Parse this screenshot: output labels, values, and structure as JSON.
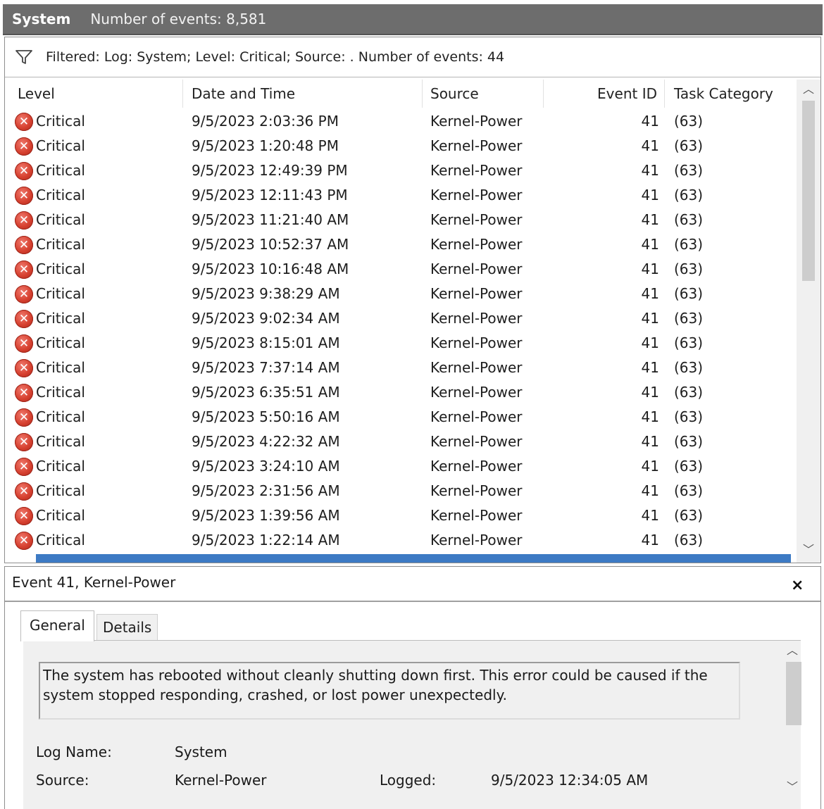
{
  "header": {
    "title": "System",
    "event_count": "Number of events: 8,581"
  },
  "filter": {
    "text": "Filtered: Log: System; Level: Critical; Source: . Number of events: 44",
    "icon": "filter-icon"
  },
  "columns": {
    "level": "Level",
    "date": "Date and Time",
    "source": "Source",
    "event_id": "Event ID",
    "task": "Task Category"
  },
  "rows": [
    {
      "level": "Critical",
      "date": "9/5/2023 2:03:36 PM",
      "source": "Kernel-Power",
      "event_id": "41",
      "task": "(63)"
    },
    {
      "level": "Critical",
      "date": "9/5/2023 1:20:48 PM",
      "source": "Kernel-Power",
      "event_id": "41",
      "task": "(63)"
    },
    {
      "level": "Critical",
      "date": "9/5/2023 12:49:39 PM",
      "source": "Kernel-Power",
      "event_id": "41",
      "task": "(63)"
    },
    {
      "level": "Critical",
      "date": "9/5/2023 12:11:43 PM",
      "source": "Kernel-Power",
      "event_id": "41",
      "task": "(63)"
    },
    {
      "level": "Critical",
      "date": "9/5/2023 11:21:40 AM",
      "source": "Kernel-Power",
      "event_id": "41",
      "task": "(63)"
    },
    {
      "level": "Critical",
      "date": "9/5/2023 10:52:37 AM",
      "source": "Kernel-Power",
      "event_id": "41",
      "task": "(63)"
    },
    {
      "level": "Critical",
      "date": "9/5/2023 10:16:48 AM",
      "source": "Kernel-Power",
      "event_id": "41",
      "task": "(63)"
    },
    {
      "level": "Critical",
      "date": "9/5/2023 9:38:29 AM",
      "source": "Kernel-Power",
      "event_id": "41",
      "task": "(63)"
    },
    {
      "level": "Critical",
      "date": "9/5/2023 9:02:34 AM",
      "source": "Kernel-Power",
      "event_id": "41",
      "task": "(63)"
    },
    {
      "level": "Critical",
      "date": "9/5/2023 8:15:01 AM",
      "source": "Kernel-Power",
      "event_id": "41",
      "task": "(63)"
    },
    {
      "level": "Critical",
      "date": "9/5/2023 7:37:14 AM",
      "source": "Kernel-Power",
      "event_id": "41",
      "task": "(63)"
    },
    {
      "level": "Critical",
      "date": "9/5/2023 6:35:51 AM",
      "source": "Kernel-Power",
      "event_id": "41",
      "task": "(63)"
    },
    {
      "level": "Critical",
      "date": "9/5/2023 5:50:16 AM",
      "source": "Kernel-Power",
      "event_id": "41",
      "task": "(63)"
    },
    {
      "level": "Critical",
      "date": "9/5/2023 4:22:32 AM",
      "source": "Kernel-Power",
      "event_id": "41",
      "task": "(63)"
    },
    {
      "level": "Critical",
      "date": "9/5/2023 3:24:10 AM",
      "source": "Kernel-Power",
      "event_id": "41",
      "task": "(63)"
    },
    {
      "level": "Critical",
      "date": "9/5/2023 2:31:56 AM",
      "source": "Kernel-Power",
      "event_id": "41",
      "task": "(63)"
    },
    {
      "level": "Critical",
      "date": "9/5/2023 1:39:56 AM",
      "source": "Kernel-Power",
      "event_id": "41",
      "task": "(63)"
    },
    {
      "level": "Critical",
      "date": "9/5/2023 1:22:14 AM",
      "source": "Kernel-Power",
      "event_id": "41",
      "task": "(63)"
    }
  ],
  "detail": {
    "title": "Event 41, Kernel-Power",
    "close_icon": "×",
    "tabs": [
      "General",
      "Details"
    ],
    "message": "The system has rebooted without cleanly shutting down first. This error could be caused if the system stopped responding, crashed, or lost power unexpectedly.",
    "fields": {
      "log_name_label": "Log Name:",
      "log_name_value": "System",
      "source_label": "Source:",
      "source_value": "Kernel-Power",
      "logged_label": "Logged:",
      "logged_value": "9/5/2023 12:34:05 AM"
    }
  },
  "colors": {
    "header_bg": "#6d6d6d",
    "selection": "#3d7ac4",
    "critical": "#d6402f"
  }
}
